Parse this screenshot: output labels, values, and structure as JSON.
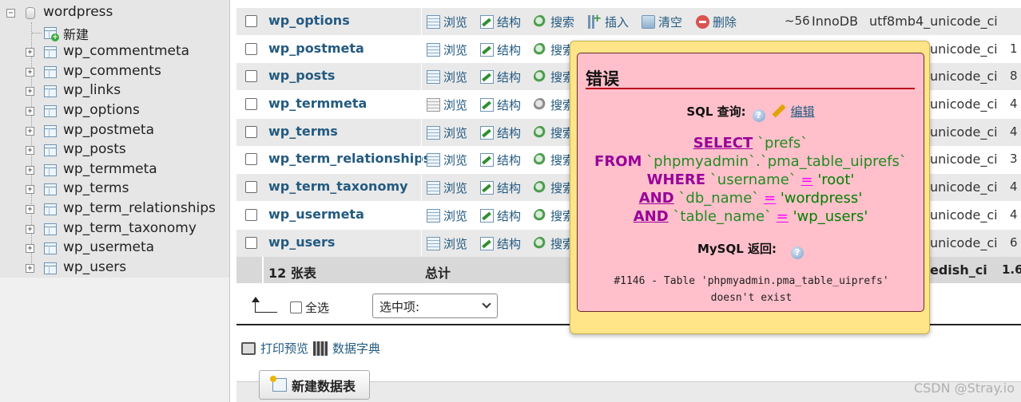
{
  "nav": {
    "database": "wordpress",
    "new_label": "新建",
    "tables": [
      "wp_commentmeta",
      "wp_comments",
      "wp_links",
      "wp_options",
      "wp_postmeta",
      "wp_posts",
      "wp_termmeta",
      "wp_terms",
      "wp_term_relationships",
      "wp_term_taxonomy",
      "wp_usermeta",
      "wp_users"
    ]
  },
  "actions": {
    "browse": "浏览",
    "structure": "结构",
    "search": "搜索",
    "insert": "插入",
    "empty": "清空",
    "drop": "删除"
  },
  "rows": [
    {
      "name": "wp_options",
      "rows": "~56",
      "engine": "InnoDB",
      "collation": "utf8mb4_unicode_ci"
    },
    {
      "name": "wp_postmeta",
      "collation": "unicode_ci",
      "extra": "1"
    },
    {
      "name": "wp_posts",
      "collation": "unicode_ci",
      "extra": "8"
    },
    {
      "name": "wp_termmeta",
      "collation": "unicode_ci",
      "extra": "4"
    },
    {
      "name": "wp_terms",
      "collation": "unicode_ci",
      "extra": "4"
    },
    {
      "name": "wp_term_relationships",
      "collation": "unicode_ci",
      "extra": "3"
    },
    {
      "name": "wp_term_taxonomy",
      "collation": "unicode_ci",
      "extra": "4"
    },
    {
      "name": "wp_usermeta",
      "collation": "unicode_ci",
      "extra": "4"
    },
    {
      "name": "wp_users",
      "collation": "unicode_ci",
      "extra": "6"
    }
  ],
  "footer": {
    "count": "12 张表",
    "total": "总计",
    "collation": "edish_ci",
    "size": "1.6"
  },
  "controls": {
    "select_all": "全选",
    "with_selected": "选中项:",
    "print_preview": "打印预览",
    "data_dictionary": "数据字典",
    "new_table": "新建数据表"
  },
  "error": {
    "title": "错误",
    "sql_query_label": "SQL 查询:",
    "edit": "编辑",
    "sql": {
      "select": "SELECT",
      "select_col": "`prefs`",
      "from": "FROM",
      "from_tbl": "`phpmyadmin`.`pma_table_uiprefs`",
      "where": "WHERE",
      "col1": "`username`",
      "eq": "=",
      "val1": "'root'",
      "and": "AND",
      "col2": "`db_name`",
      "val2": "'wordpress'",
      "col3": "`table_name`",
      "val3": "'wp_users'"
    },
    "mysql_returned": "MySQL 返回:",
    "message_line1": "#1146 - Table 'phpmyadmin.pma_table_uiprefs'",
    "message_line2": "doesn't exist"
  },
  "watermark": "CSDN @Stray.io"
}
